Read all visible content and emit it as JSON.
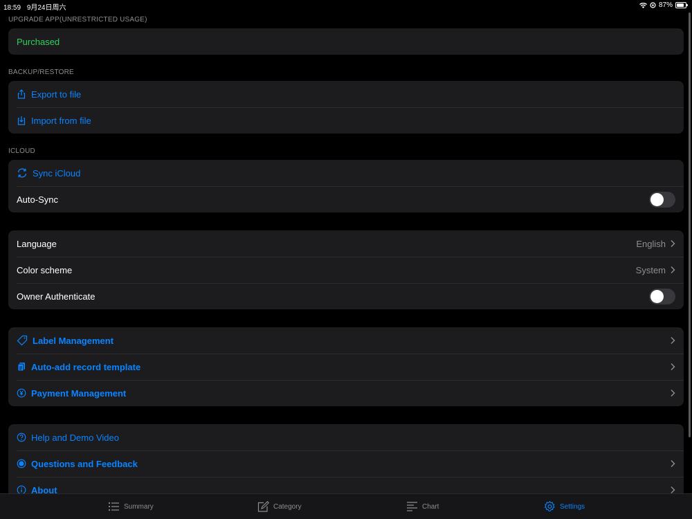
{
  "status_bar": {
    "time": "18:59",
    "date": "9月24日周六",
    "battery": "87%"
  },
  "sections": {
    "upgrade": {
      "header": "UPGRADE APP(UNRESTRICTED USAGE)",
      "purchased": "Purchased"
    },
    "backup": {
      "header": "BACKUP/RESTORE",
      "export": "Export to file",
      "import": "Import from file"
    },
    "icloud": {
      "header": "ICLOUD",
      "sync": "Sync iCloud",
      "auto_sync": "Auto-Sync"
    },
    "general": {
      "language_label": "Language",
      "language_value": "English",
      "color_scheme_label": "Color scheme",
      "color_scheme_value": "System",
      "owner_auth_label": "Owner Authenticate"
    },
    "management": {
      "label_management": "Label Management",
      "auto_add_template": "Auto-add record template",
      "payment_management": "Payment Management"
    },
    "support": {
      "help": "Help and Demo Video",
      "feedback": "Questions and Feedback",
      "about": "About"
    }
  },
  "toggles": {
    "auto_sync_on": false,
    "owner_authenticate_on": false
  },
  "tabs": {
    "summary": "Summary",
    "category": "Category",
    "chart": "Chart",
    "settings": "Settings",
    "active": "settings"
  },
  "colors": {
    "accent": "#0a84ff",
    "success": "#30d158",
    "background": "#000000",
    "cell": "#1c1c1e"
  }
}
